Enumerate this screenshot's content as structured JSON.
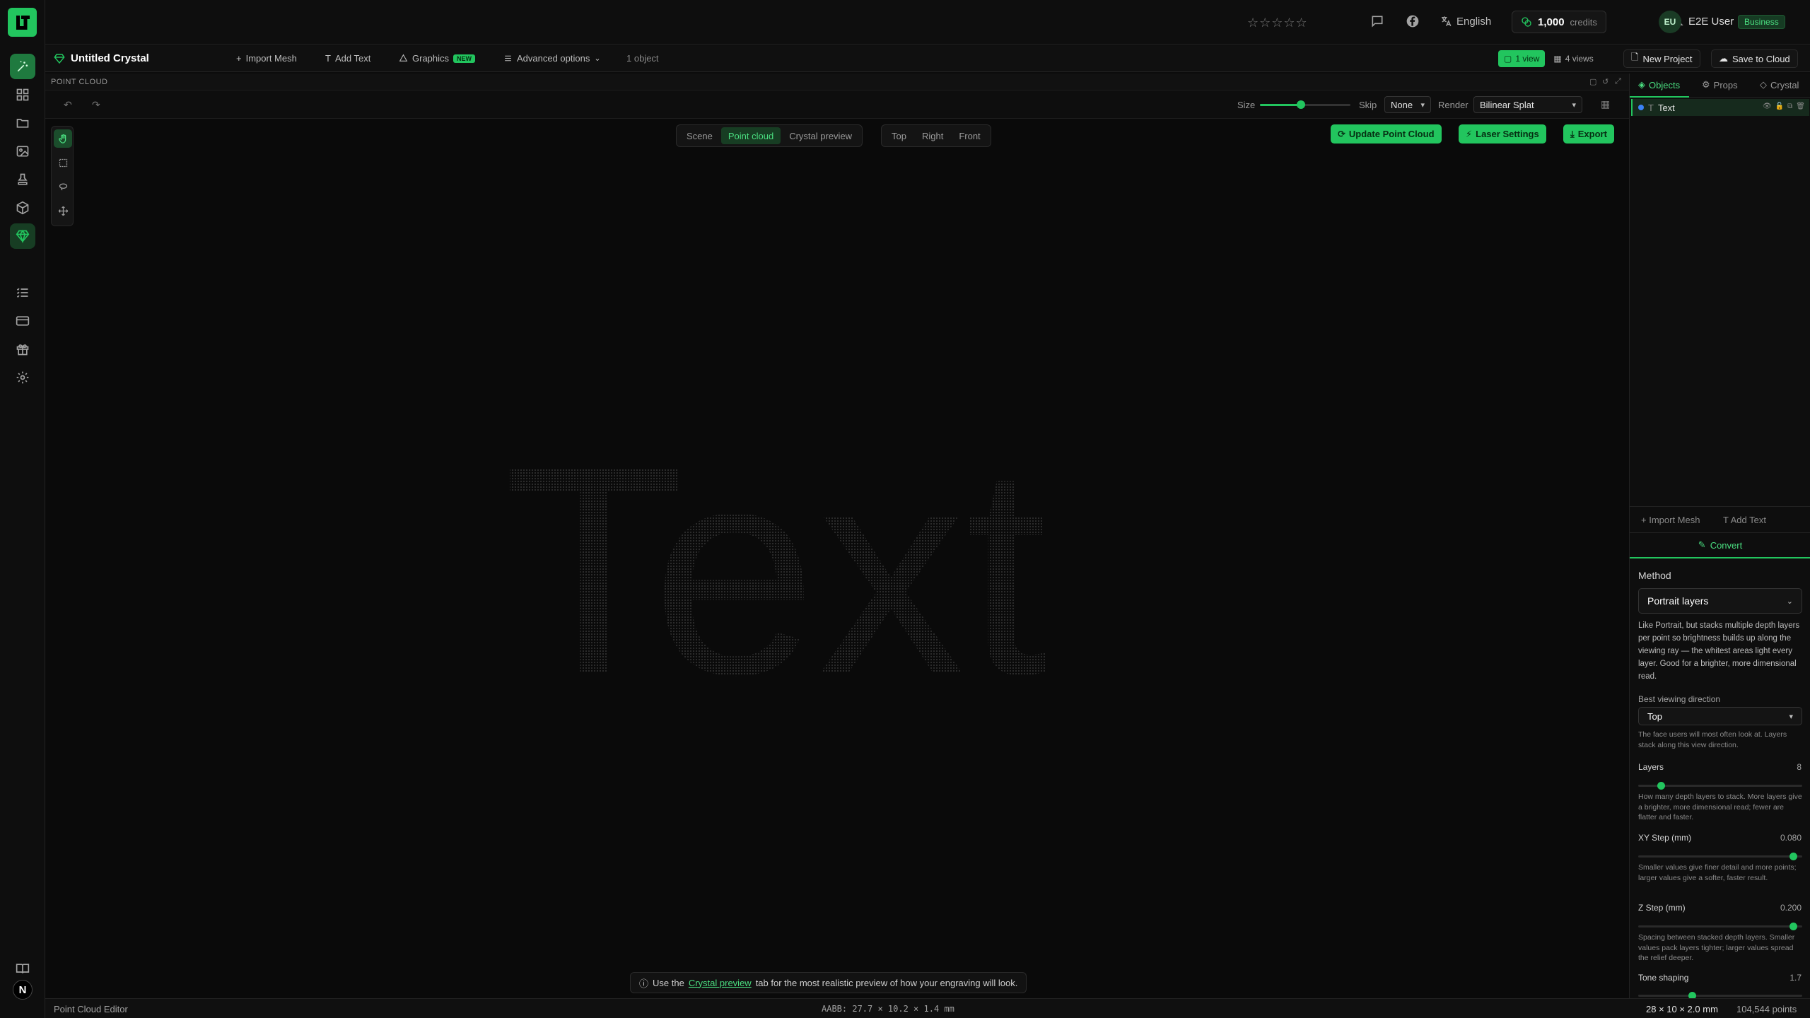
{
  "app": {
    "logo_text": "LT"
  },
  "topbar": {
    "rating_stars": "☆☆☆☆☆",
    "language": "English",
    "credits_value": "1,000",
    "credits_label": "credits",
    "user_initials": "EU",
    "user_name": "E2E User",
    "plan_badge": "Business"
  },
  "project": {
    "title": "Untitled Crystal",
    "import_mesh": "Import Mesh",
    "add_text": "Add Text",
    "graphics": "Graphics",
    "graphics_badge": "NEW",
    "advanced": "Advanced options",
    "object_count": "1 object",
    "view_one": "1 view",
    "view_four": "4 views",
    "new_project": "New Project",
    "save_cloud": "Save to Cloud"
  },
  "panel": {
    "title": "POINT CLOUD"
  },
  "toolbar": {
    "size_label": "Size",
    "size_value": 0.45,
    "skip_label": "Skip",
    "skip_value": "None",
    "render_label": "Render",
    "render_value": "Bilinear Splat"
  },
  "viewport": {
    "modes": [
      "Scene",
      "Point cloud",
      "Crystal preview"
    ],
    "active_mode": "Point cloud",
    "views": [
      "Top",
      "Right",
      "Front"
    ],
    "update_btn": "Update Point Cloud",
    "laser_btn": "Laser Settings",
    "export_btn": "Export",
    "cloud_text": "Text",
    "hint_prefix": "Use the",
    "hint_link": "Crystal preview",
    "hint_suffix": "tab for the most realistic preview of how your engraving will look."
  },
  "statusbar": {
    "left": "Point Cloud Editor",
    "aabb": "AABB: 27.7 × 10.2 × 1.4 mm",
    "dims": "28 × 10 × 2.0 mm",
    "points": "104,544 points"
  },
  "right_panel": {
    "tabs": [
      "Objects",
      "Props",
      "Crystal"
    ],
    "object_name": "Text",
    "import_mesh": "Import Mesh",
    "add_text": "Add Text",
    "convert_tab": "Convert",
    "method_label": "Method",
    "method_value": "Portrait layers",
    "method_desc": "Like Portrait, but stacks multiple depth layers per point so brightness builds up along the viewing ray — the whitest areas light every layer. Good for a brighter, more dimensional read.",
    "view_dir_label": "Best viewing direction",
    "view_dir_value": "Top",
    "view_dir_help": "The face users will most often look at. Layers stack along this view direction.",
    "layers_label": "Layers",
    "layers_value": "8",
    "layers_fraction": 0.12,
    "layers_help": "How many depth layers to stack. More layers give a brighter, more dimensional read; fewer are flatter and faster.",
    "xy_label": "XY Step (mm)",
    "xy_value": "0.080",
    "xy_fraction": 0.97,
    "xy_help": "Smaller values give finer detail and more points; larger values give a softer, faster result.",
    "z_label": "Z Step (mm)",
    "z_value": "0.200",
    "z_fraction": 0.97,
    "z_help": "Spacing between stacked depth layers. Smaller values pack layers tighter; larger values spread the relief deeper.",
    "tone_label": "Tone shaping",
    "tone_value": "1.7",
    "tone_fraction": 0.32
  },
  "colors": {
    "accent": "#22c55e",
    "background": "#0a0a0a",
    "panel": "#0e0e0e"
  }
}
